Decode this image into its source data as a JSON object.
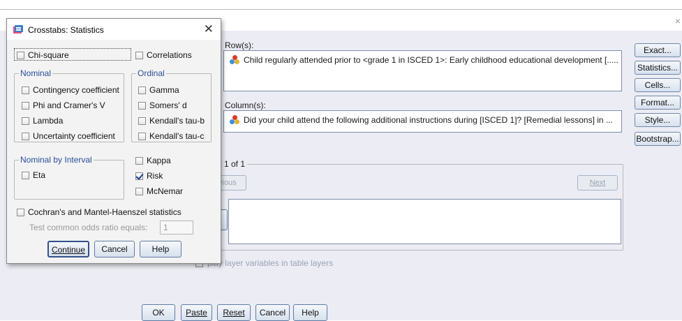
{
  "window": {
    "close_glyph": "×"
  },
  "main": {
    "row_label": "Row(s):",
    "row_item": "Child regularly attended prior to <grade 1 in ISCED 1>: Early childhood educational development [.....",
    "column_label": "Column(s):",
    "column_item": "Did your child attend the following additional instructions during [ISCED 1]? [Remedial lessons] in ...",
    "layer_label": "1 of 1",
    "previous_label": "vious",
    "next_label": "Next",
    "display_layer_label": "play layer variables in table layers",
    "side_buttons": [
      "Exact...",
      "Statistics...",
      "Cells...",
      "Format...",
      "Style...",
      "Bootstrap..."
    ],
    "bottom_buttons": [
      "OK",
      "Paste",
      "Reset",
      "Cancel",
      "Help"
    ]
  },
  "dialog": {
    "title": "Crosstabs: Statistics",
    "close_glyph": "✕",
    "chi_square": "Chi-square",
    "correlations": "Correlations",
    "nominal_title": "Nominal",
    "nominal": [
      "Contingency coefficient",
      "Phi and Cramer's V",
      "Lambda",
      "Uncertainty coefficient"
    ],
    "ordinal_title": "Ordinal",
    "ordinal": [
      "Gamma",
      "Somers' d",
      "Kendall's tau-b",
      "Kendall's tau-c"
    ],
    "nominal_interval_title": "Nominal by Interval",
    "eta": "Eta",
    "kappa": "Kappa",
    "risk": "Risk",
    "mcnemar": "McNemar",
    "cochran": "Cochran's and Mantel-Haenszel statistics",
    "odds_label": "Test common odds ratio equals:",
    "odds_value": "1",
    "buttons": [
      "Continue",
      "Cancel",
      "Help"
    ]
  },
  "colors": {
    "accent": "#2a4d9a",
    "button_border": "#5f7ba5",
    "background": "#ececf4"
  },
  "icons": [
    "variable-icon",
    "dialog-app-icon",
    "close-icon",
    "checkbox-icon"
  ]
}
